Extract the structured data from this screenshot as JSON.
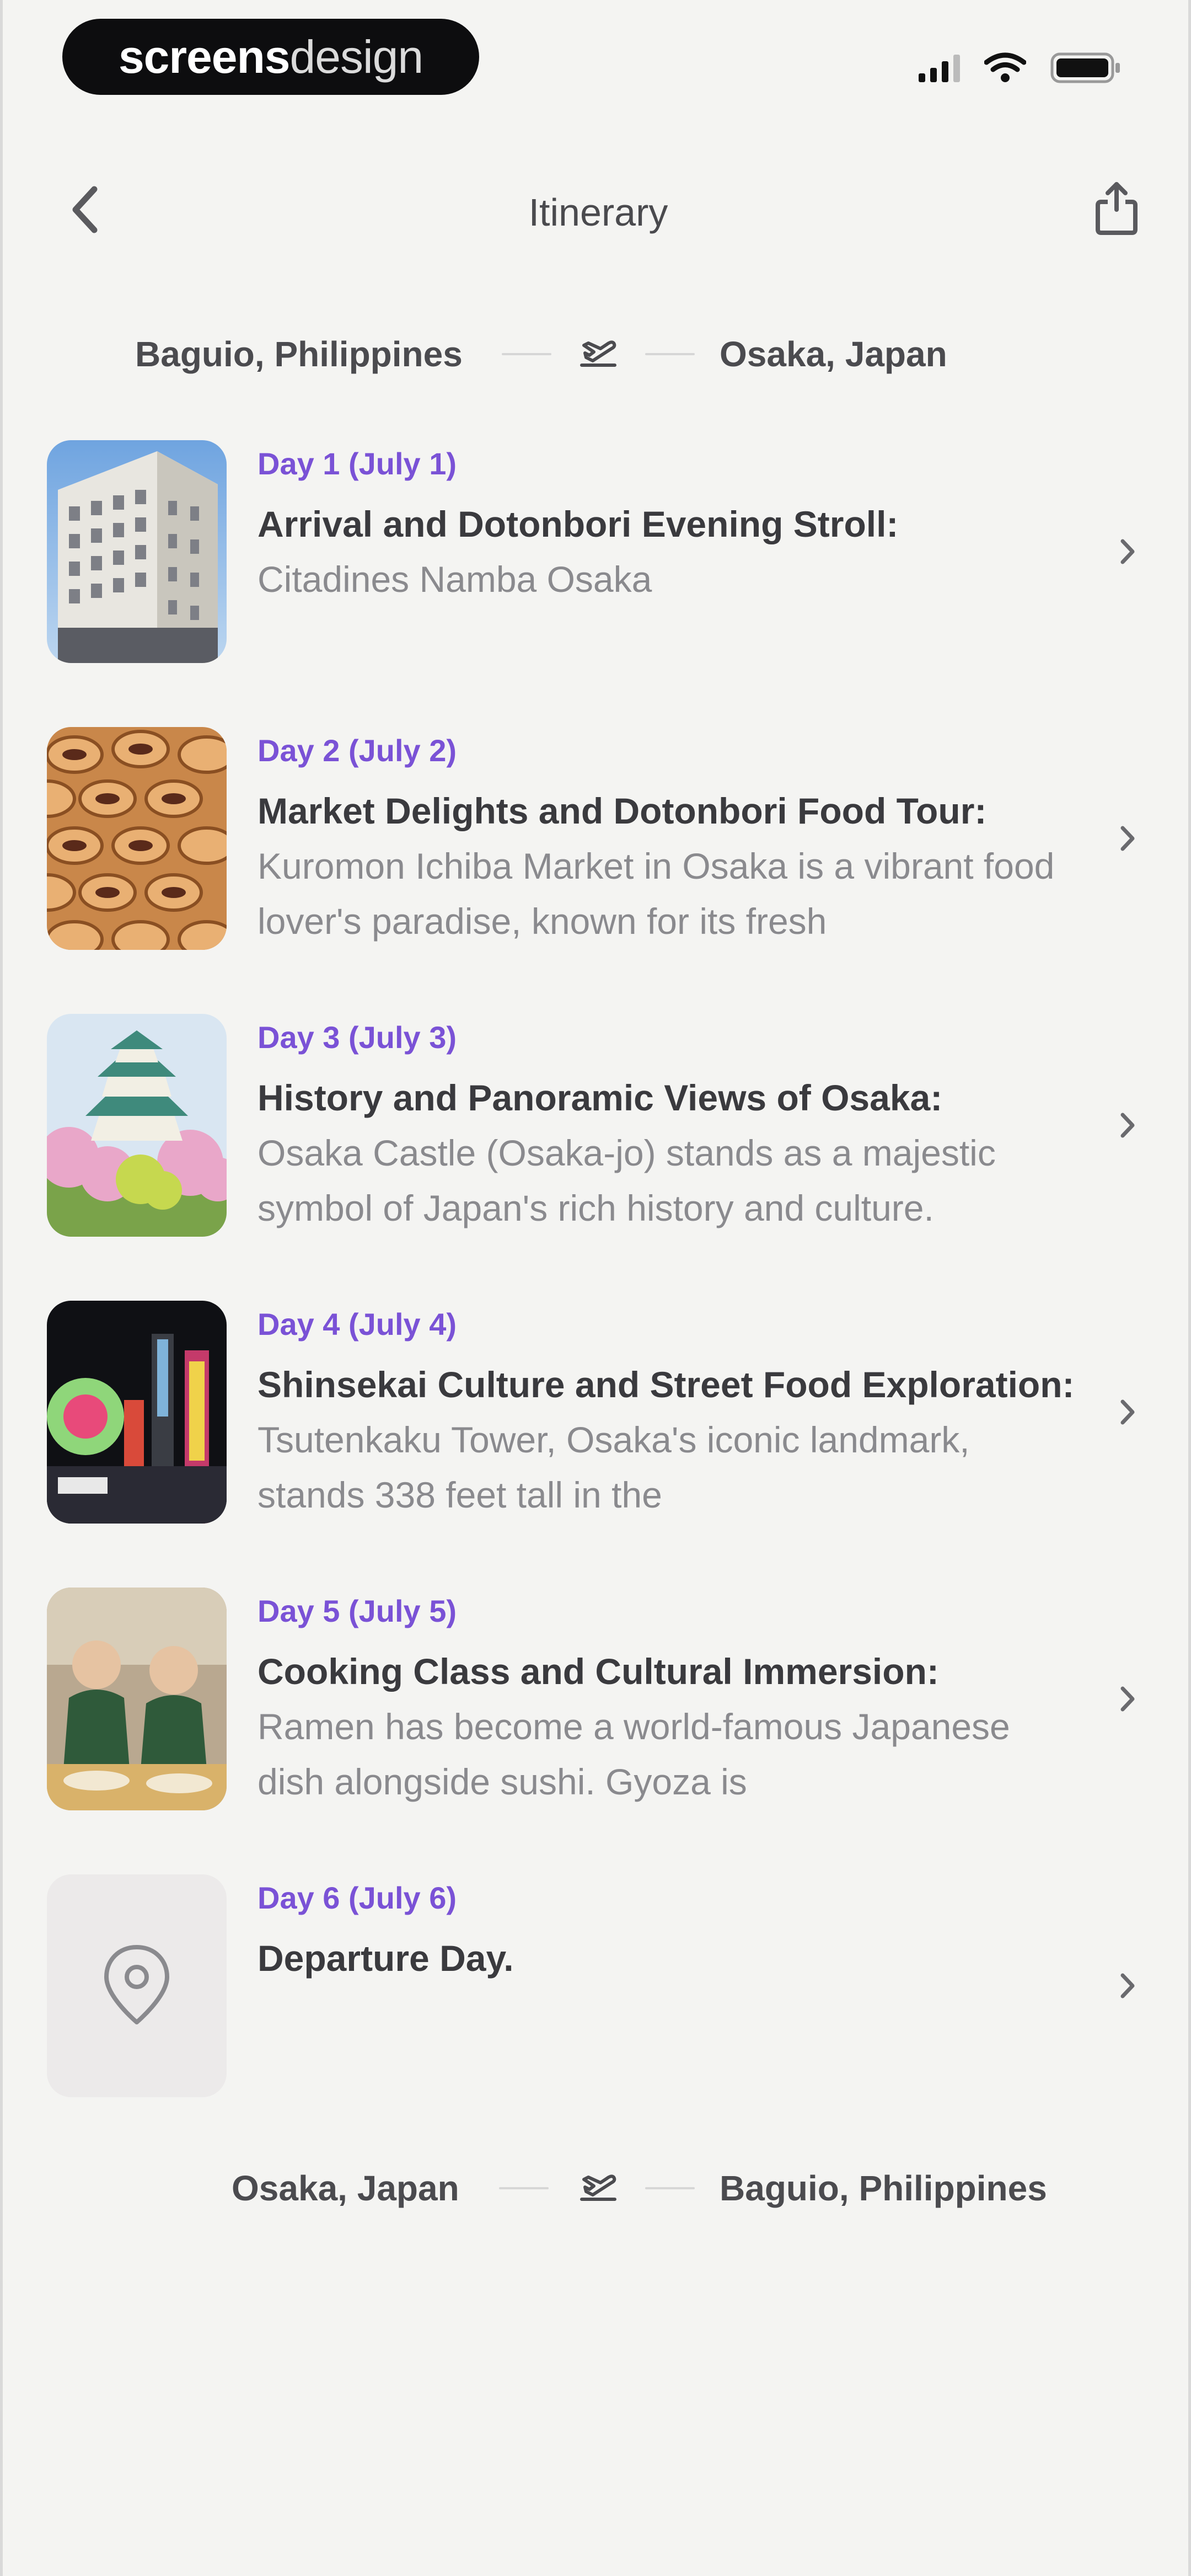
{
  "status_bar": {
    "logo_bold": "screens",
    "logo_light": "design"
  },
  "header": {
    "title": "Itinerary"
  },
  "outbound": {
    "from": "Baguio, Philippines",
    "to": "Osaka, Japan"
  },
  "return_trip": {
    "from": "Osaka, Japan",
    "to": "Baguio, Philippines"
  },
  "days": [
    {
      "label": "Day 1 (July 1)",
      "title": "Arrival and Dotonbori Evening Stroll:",
      "text": "Citadines Namba Osaka",
      "image": "hotel-building-photo"
    },
    {
      "label": "Day 2 (July 2)",
      "title": "Market Delights and Dotonbori Food Tour:",
      "text": "Kuromon Ichiba Market in Osaka is a vibrant food lover's paradise, known for its fresh",
      "image": "market-food-photo"
    },
    {
      "label": "Day 3 (July 3)",
      "title": "History and Panoramic Views of Osaka:",
      "text": "Osaka Castle (Osaka-jo) stands as a majestic symbol of Japan's rich history and culture.",
      "image": "osaka-castle-photo"
    },
    {
      "label": "Day 4 (July 4)",
      "title": "Shinsekai Culture and Street Food Exploration:",
      "text": "Tsutenkaku Tower, Osaka's iconic landmark, stands 338 feet tall in the",
      "image": "shinsekai-night-photo"
    },
    {
      "label": "Day 5 (July 5)",
      "title": "Cooking Class and Cultural Immersion:",
      "text": "Ramen has become a world-famous Japanese dish alongside sushi. Gyoza is",
      "image": "cooking-class-photo"
    },
    {
      "label": "Day 6 (July 6)",
      "title": "Departure Day.",
      "text": "",
      "image": "location-pin-icon"
    }
  ],
  "colors": {
    "accent": "#7a52d6",
    "background": "#f4f4f2",
    "text": "#2a2a2e",
    "muted": "#8a8a8e"
  }
}
